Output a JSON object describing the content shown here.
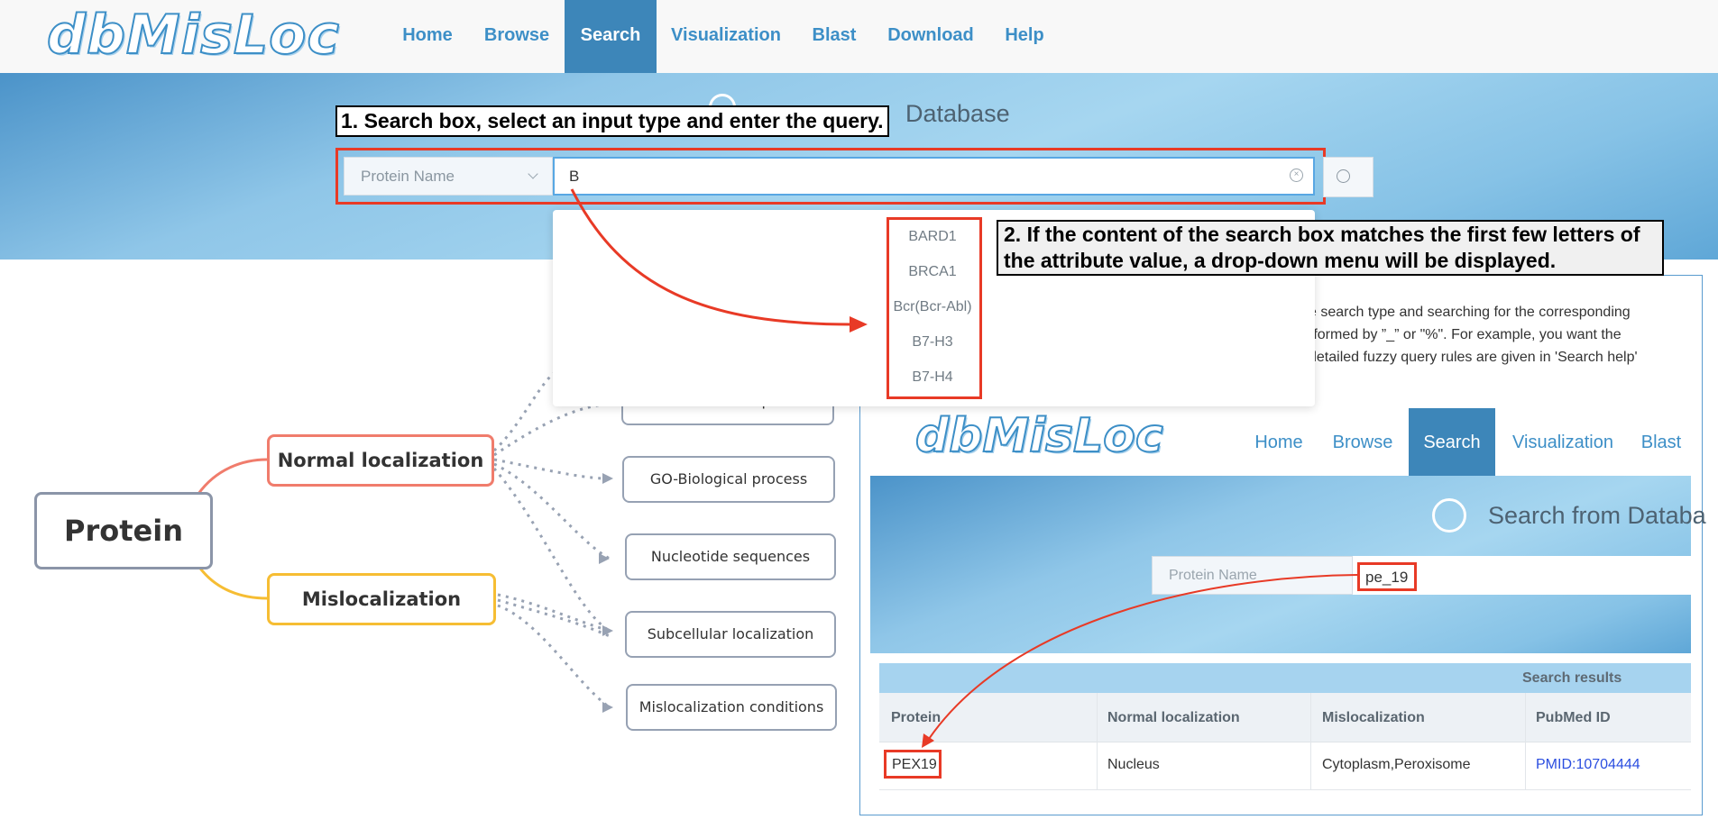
{
  "navbar": {
    "logo": "dbMisLoc",
    "items": [
      {
        "label": "Home"
      },
      {
        "label": "Browse"
      },
      {
        "label": "Search"
      },
      {
        "label": "Visualization"
      },
      {
        "label": "Blast"
      },
      {
        "label": "Download"
      },
      {
        "label": "Help"
      }
    ],
    "active": "Search"
  },
  "hero": {
    "title": "Database"
  },
  "annotations": {
    "step1": "1. Search box, select an input type and enter the query.",
    "step2": "2. If the content of the search box matches the first few letters of the attribute value, a drop-down menu will be displayed."
  },
  "search": {
    "select_value": "Protein Name",
    "input_value": "B",
    "suggestions": [
      "BARD1",
      "BRCA1",
      "Bcr(Bcr-Abl)",
      "B7-H3",
      "B7-H4"
    ]
  },
  "mindmap": {
    "root": "Protein",
    "branches": [
      {
        "label": "Normal localization",
        "color": "#f07c6c"
      },
      {
        "label": "Mislocalization",
        "color": "#f6bd33"
      }
    ],
    "leaves": [
      "GO-Cellular component",
      "GO-Biological process",
      "Nucleotide sequences",
      "Subcellular localization",
      "Mislocalization conditions"
    ]
  },
  "help_text": {
    "lines": [
      "e search type and searching for the corresponding",
      "rformed by ”_” or \"%\". For example, you want the",
      "detailed fuzzy query rules are given in 'Search help'"
    ]
  },
  "example": {
    "logo": "dbMisLoc",
    "nav_items": [
      {
        "label": "Home"
      },
      {
        "label": "Browse"
      },
      {
        "label": "Search"
      },
      {
        "label": "Visualization"
      },
      {
        "label": "Blast"
      }
    ],
    "hero_title": "Search from Databa",
    "select_value": "Protein Name",
    "query": "pe_19",
    "results_title": "Search results",
    "columns": [
      "Protein",
      "Normal localization",
      "Mislocalization",
      "PubMed ID"
    ],
    "rows": [
      [
        "PEX19",
        "Nucleus",
        "Cytoplasm,Peroxisome",
        "PMID:10704444"
      ]
    ]
  },
  "colors": {
    "brand": "#3d8fc7",
    "active_tab": "#3d86b9",
    "annotation_red": "#e83a26",
    "link": "#2b4ee0"
  }
}
